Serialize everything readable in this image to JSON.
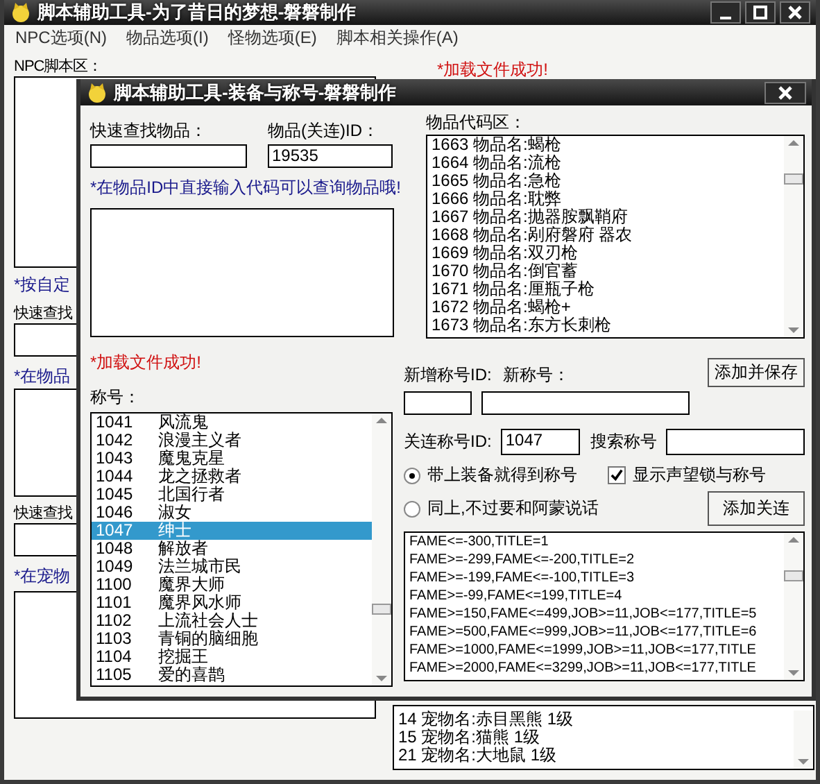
{
  "back_window": {
    "title": "脚本辅助工具-为了昔日的梦想-磐磐制作",
    "menu": [
      {
        "label": "NPC选项(N)"
      },
      {
        "label": "物品选项(I)"
      },
      {
        "label": "怪物选项(E)"
      },
      {
        "label": "脚本相关操作(A)"
      }
    ],
    "status_message": "*加载文件成功!",
    "left_panel": {
      "npc_script_label": "NPC脚本区：",
      "hint_custom": "*按自定",
      "quick_find_label": "快速查找",
      "hint_item_id": "*在物品",
      "quick_find_label_2": "快速查找",
      "hint_pet_id": "*在宠物"
    },
    "pet_list": [
      "14 宠物名:赤目黑熊 1级",
      "15 宠物名:猫熊 1级",
      "21 宠物名:大地鼠 1级"
    ]
  },
  "front_window": {
    "title": "脚本辅助工具-装备与称号-磐磐制作",
    "quick_find": {
      "label": "快速查找物品："
    },
    "item_id": {
      "label": "物品(关连)ID：",
      "value": "19535"
    },
    "hint": "*在物品ID中直接输入代码可以查询物品哦!",
    "status_message": "*加载文件成功!",
    "titles": {
      "label": "称号：",
      "rows": [
        {
          "id": "1041",
          "name": "风流鬼",
          "selected": false
        },
        {
          "id": "1042",
          "name": "浪漫主义者",
          "selected": false
        },
        {
          "id": "1043",
          "name": "魔鬼克星",
          "selected": false
        },
        {
          "id": "1044",
          "name": "龙之拯救者",
          "selected": false
        },
        {
          "id": "1045",
          "name": "北国行者",
          "selected": false
        },
        {
          "id": "1046",
          "name": "淑女",
          "selected": false
        },
        {
          "id": "1047",
          "name": "绅士",
          "selected": true
        },
        {
          "id": "1048",
          "name": "解放者",
          "selected": false
        },
        {
          "id": "1049",
          "name": "法兰城市民",
          "selected": false
        },
        {
          "id": "1100",
          "name": "魔界大师",
          "selected": false
        },
        {
          "id": "1101",
          "name": "魔界风水师",
          "selected": false
        },
        {
          "id": "1102",
          "name": "上流社会人士",
          "selected": false
        },
        {
          "id": "1103",
          "name": "青铜的脑细胞",
          "selected": false
        },
        {
          "id": "1104",
          "name": "挖掘王",
          "selected": false
        },
        {
          "id": "1105",
          "name": "爱的喜鹊",
          "selected": false
        }
      ]
    },
    "item_codes": {
      "label": "物品代码区：",
      "rows": [
        "1663 物品名:蝎枪",
        "1664 物品名:流枪",
        "1665 物品名:急枪",
        "1666 物品名:耽弊",
        "1667 物品名:抛器胺飘鞘府",
        "1668 物品名:剐府磐府 器农",
        "1669 物品名:双刃枪",
        "1670 物品名:倒官蓄",
        "1671 物品名:厘瓶子枪",
        "1672 物品名:蝎枪+",
        "1673 物品名:东方长刺枪"
      ]
    },
    "add_save_button": "添加并保存",
    "new_title_id_label": "新增称号ID:",
    "new_title_label": "新称号：",
    "linked_title_id": {
      "label": "关连称号ID:",
      "value": "1047"
    },
    "search_title_label": "搜索称号",
    "radios": [
      {
        "label": "带上装备就得到称号",
        "selected": true
      },
      {
        "label": "同上,不过要和阿蒙说话",
        "selected": false
      }
    ],
    "checkbox": {
      "label": "显示声望锁与称号",
      "checked": true
    },
    "add_link_button": "添加关连",
    "fame_rules": [
      "FAME<=-300,TITLE=1",
      "FAME>=-299,FAME<=-200,TITLE=2",
      "FAME>=-199,FAME<=-100,TITLE=3",
      "FAME>=-99,FAME<=199,TITLE=4",
      "FAME>=150,FAME<=499,JOB>=11,JOB<=177,TITLE=5",
      "FAME>=500,FAME<=999,JOB>=11,JOB<=177,TITLE=6",
      "FAME>=1000,FAME<=1999,JOB>=11,JOB<=177,TITLE",
      "FAME>=2000,FAME<=3299,JOB>=11,JOB<=177,TITLE"
    ]
  }
}
